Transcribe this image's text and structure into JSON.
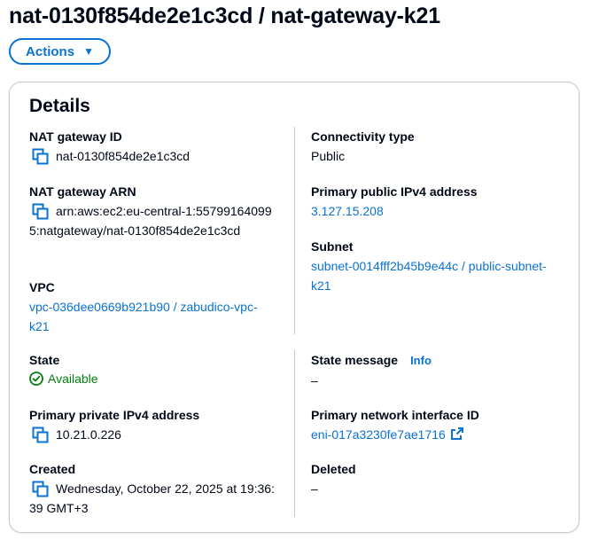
{
  "header": {
    "title": "nat-0130f854de2e1c3cd / nat-gateway-k21",
    "actions_label": "Actions"
  },
  "details": {
    "heading": "Details",
    "nat_gateway_id": {
      "label": "NAT gateway ID",
      "value": "nat-0130f854de2e1c3cd"
    },
    "nat_gateway_arn": {
      "label": "NAT gateway ARN",
      "value": "arn:aws:ec2:eu-central-1:557991640995:natgateway/nat-0130f854de2e1c3cd"
    },
    "vpc": {
      "label": "VPC",
      "value": "vpc-036dee0669b921b90 / zabudico-vpc-k21"
    },
    "connectivity_type": {
      "label": "Connectivity type",
      "value": "Public"
    },
    "primary_public_ipv4": {
      "label": "Primary public IPv4 address",
      "value": "3.127.15.208"
    },
    "subnet": {
      "label": "Subnet",
      "value": "subnet-0014fff2b45b9e44c / public-subnet-k21"
    },
    "state": {
      "label": "State",
      "value": "Available"
    },
    "primary_private_ipv4": {
      "label": "Primary private IPv4 address",
      "value": "10.21.0.226"
    },
    "created": {
      "label": "Created",
      "value": "Wednesday, October 22, 2025 at 19:36:39 GMT+3"
    },
    "state_message": {
      "label": "State message",
      "info": "Info",
      "value": "–"
    },
    "primary_network_interface": {
      "label": "Primary network interface ID",
      "value": "eni-017a3230fe7ae1716"
    },
    "deleted": {
      "label": "Deleted",
      "value": "–"
    }
  },
  "colors": {
    "link": "#0972d3",
    "success": "#037f0c",
    "text": "#000716",
    "border": "#c6c6cd"
  },
  "icons": [
    "copy-icon",
    "caret-down-icon",
    "status-success-icon",
    "external-link-icon"
  ]
}
